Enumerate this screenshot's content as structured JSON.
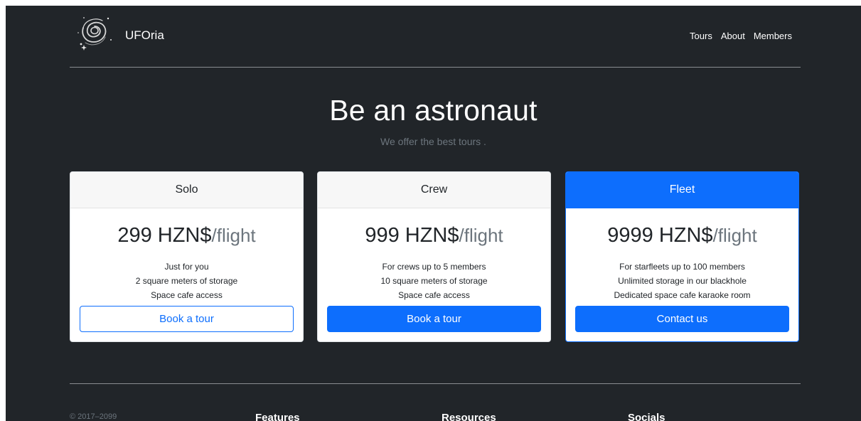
{
  "header": {
    "brand": "UFOria",
    "nav": [
      "Tours",
      "About",
      "Members"
    ]
  },
  "hero": {
    "title": "Be an astronaut",
    "subtitle": "We offer the best tours ."
  },
  "plans": [
    {
      "name": "Solo",
      "price": "299 HZN$",
      "per": "/flight",
      "features": [
        "Just for you",
        "2 square meters of storage",
        "Space cafe access"
      ],
      "button": "Book a tour"
    },
    {
      "name": "Crew",
      "price": "999 HZN$",
      "per": "/flight",
      "features": [
        "For crews up to 5 members",
        "10 square meters of storage",
        "Space cafe access"
      ],
      "button": "Book a tour"
    },
    {
      "name": "Fleet",
      "price": "9999 HZN$",
      "per": "/flight",
      "features": [
        "For starfleets up to 100 members",
        "Unlimited storage in our blackhole",
        "Dedicated space cafe karaoke room"
      ],
      "button": "Contact us"
    }
  ],
  "footer": {
    "copyright": "© 2017–2099",
    "columns": [
      "Features",
      "Resources",
      "Socials"
    ]
  },
  "colors": {
    "background": "#212529",
    "primary": "#0d6efd",
    "muted": "#6c757d"
  },
  "icons": {
    "logo": "spiral-galaxy-icon"
  }
}
